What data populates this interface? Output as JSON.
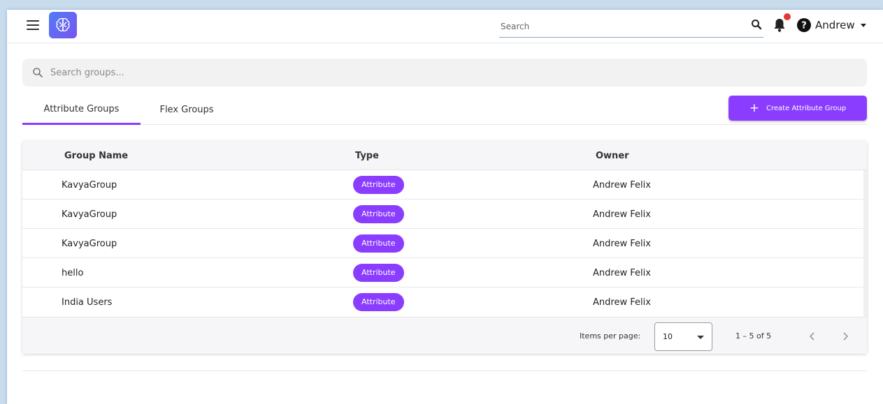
{
  "header": {
    "search_placeholder": "Search",
    "user_name": "Andrew",
    "notification_dot_color": "#e53935"
  },
  "group_search": {
    "placeholder": "Search groups..."
  },
  "tabs": [
    {
      "label": "Attribute Groups",
      "active": true
    },
    {
      "label": "Flex Groups",
      "active": false
    }
  ],
  "create_button": {
    "label": "Create Attribute Group",
    "color": "#8b3dff"
  },
  "table": {
    "columns": [
      "Group Name",
      "Type",
      "Owner"
    ],
    "rows": [
      {
        "name": "KavyaGroup",
        "type": "Attribute",
        "owner": "Andrew Felix"
      },
      {
        "name": "KavyaGroup",
        "type": "Attribute",
        "owner": "Andrew Felix"
      },
      {
        "name": "KavyaGroup",
        "type": "Attribute",
        "owner": "Andrew Felix"
      },
      {
        "name": "hello",
        "type": "Attribute",
        "owner": "Andrew Felix"
      },
      {
        "name": "India Users",
        "type": "Attribute",
        "owner": "Andrew Felix"
      }
    ]
  },
  "paginator": {
    "items_per_page_label": "Items per page:",
    "items_per_page_value": "10",
    "range_label": "1 – 5 of 5"
  },
  "icons": {
    "menu": "hamburger-menu-icon",
    "logo": "brain-logo-icon",
    "search": "search-icon",
    "bell": "bell-icon",
    "help": "help-circle-icon",
    "caret": "caret-down-icon",
    "prev": "chevron-left-icon",
    "next": "chevron-right-icon",
    "plus": "plus-icon"
  }
}
